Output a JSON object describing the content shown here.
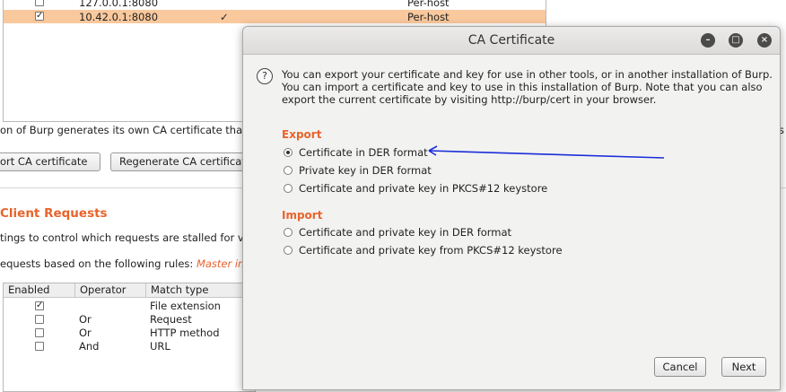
{
  "listeners": {
    "rows": [
      {
        "address": "127.0.0.1:8080",
        "checked": false,
        "invisible": "",
        "certificate": "Per-host"
      },
      {
        "address": "10.42.0.1:8080",
        "checked": true,
        "invisible": "✓",
        "certificate": "Per-host"
      }
    ]
  },
  "background": {
    "ca_text": "on of Burp generates its own CA certificate that",
    "right_edge_text": "s",
    "export_ca_button": "ort CA certificate",
    "regenerate_button": "Regenerate CA certificat",
    "client_requests_title": "Client Requests",
    "intercept_desc": "tings to control which requests are stalled for vi",
    "rules_desc": "equests based on the following rules:",
    "rules_master": "Master in",
    "rules_table": {
      "headers": [
        "Enabled",
        "Operator",
        "Match type"
      ],
      "rows": [
        {
          "enabled": true,
          "operator": "",
          "match_type": "File extension"
        },
        {
          "enabled": false,
          "operator": "Or",
          "match_type": "Request"
        },
        {
          "enabled": false,
          "operator": "Or",
          "match_type": "HTTP method"
        },
        {
          "enabled": false,
          "operator": "And",
          "match_type": "URL"
        }
      ]
    }
  },
  "dialog": {
    "title": "CA Certificate",
    "description": "You can export your certificate and key for use in other tools, or in another installation of Burp. You can import a certificate and key to use in this installation of Burp. Note that you can also export the current certificate by visiting http://burp/cert in your browser.",
    "export_label": "Export",
    "export_options": [
      {
        "label": "Certificate in DER format",
        "selected": true
      },
      {
        "label": "Private key in DER format",
        "selected": false
      },
      {
        "label": "Certificate and private key in PKCS#12 keystore",
        "selected": false
      }
    ],
    "import_label": "Import",
    "import_options": [
      {
        "label": "Certificate and private key in DER format",
        "selected": false
      },
      {
        "label": "Certificate and private key from PKCS#12 keystore",
        "selected": false
      }
    ],
    "cancel_label": "Cancel",
    "next_label": "Next",
    "annotation_arrow_color": "#1a2fd8"
  },
  "icons": {
    "minimize": "minimize-icon",
    "maximize": "maximize-icon",
    "close": "close-icon",
    "help": "help-icon"
  }
}
